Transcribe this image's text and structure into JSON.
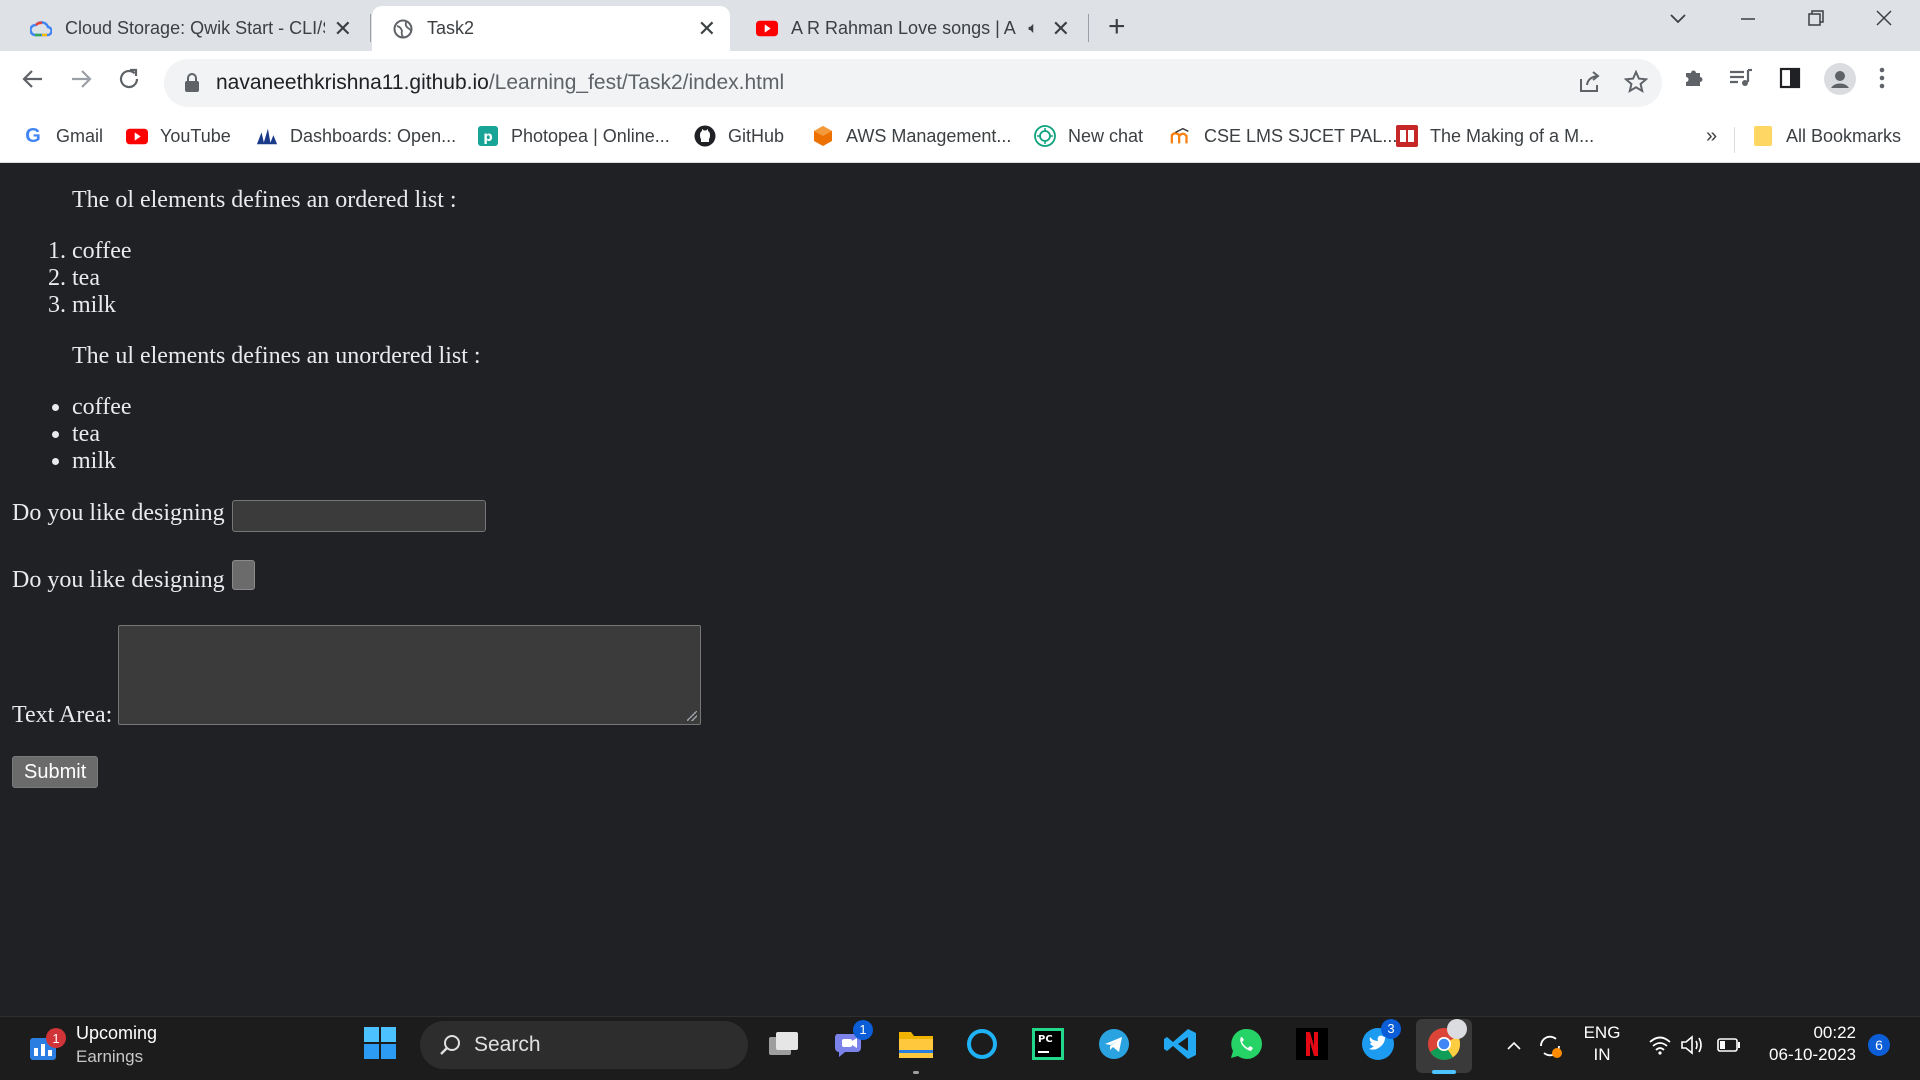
{
  "browser": {
    "tabs": [
      {
        "title": "Cloud Storage: Qwik Start - CLI/S",
        "icon": "google-cloud-icon"
      },
      {
        "title": "Task2",
        "icon": "globe-icon"
      },
      {
        "title": "A R Rahman Love songs | AR",
        "icon": "youtube-icon"
      }
    ],
    "address": {
      "host": "navaneethkrishna11.github.io",
      "path": "/Learning_fest/Task2/index.html"
    },
    "bookmarks": [
      {
        "label": "Gmail",
        "icon": "google-icon"
      },
      {
        "label": "YouTube",
        "icon": "youtube-icon"
      },
      {
        "label": "Dashboards: Open...",
        "icon": "dashboards-icon"
      },
      {
        "label": "Photopea | Online...",
        "icon": "photopea-icon"
      },
      {
        "label": "GitHub",
        "icon": "github-icon"
      },
      {
        "label": "AWS Management...",
        "icon": "aws-icon"
      },
      {
        "label": "New chat",
        "icon": "chatgpt-icon"
      },
      {
        "label": "CSE LMS SJCET PAL...",
        "icon": "moodle-icon"
      },
      {
        "label": "The Making of a M...",
        "icon": "book-icon"
      }
    ],
    "more_bookmarks": "»",
    "all_bookmarks": "All Bookmarks"
  },
  "page": {
    "ol_intro": "The ol elements defines an ordered list :",
    "ol_items": [
      "coffee",
      "tea",
      "milk"
    ],
    "ul_intro": "The ul elements defines an unordered list :",
    "ul_items": [
      "coffee",
      "tea",
      "milk"
    ],
    "text_label": "Do you like designing",
    "checkbox_label": "Do you like designing",
    "textarea_label": "Text Area:",
    "submit_label": "Submit"
  },
  "taskbar": {
    "widget_title": "Upcoming",
    "widget_subtitle": "Earnings",
    "widget_badge": "1",
    "search_placeholder": "Search",
    "teams_badge": "1",
    "twitter_badge": "3",
    "lang_top": "ENG",
    "lang_bottom": "IN",
    "time": "00:22",
    "date": "06-10-2023",
    "notif_count": "6"
  },
  "colors": {
    "page_bg": "#202124",
    "page_text": "#e8eaed",
    "accent": "#0b5ed7"
  }
}
